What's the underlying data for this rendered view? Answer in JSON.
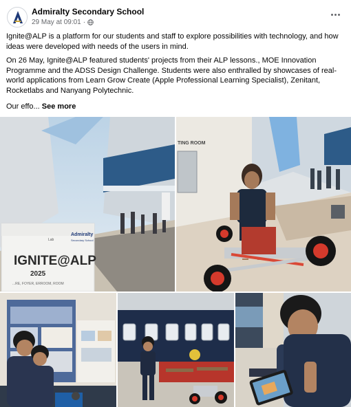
{
  "post": {
    "page_name": "Admiralty Secondary School",
    "timestamp": "29 May at 09:01",
    "separator": "·",
    "avatar_icon": "school-crest-icon",
    "audience_icon": "globe-icon",
    "more_icon": "more-options-icon",
    "paragraphs": [
      "Ignite@ALP is a platform for our students and staff to explore possibilities with technology, and how ideas were developed with needs of the users in mind.",
      "On 26 May, Ignite@ALP featured students' projects from their ALP lessons., MOE Innovation Programme and the ADSS Design Challenge. Students were also enthralled by showcases of real-world applications from Learn Grow Create (Apple Professional Learning Specialist), Zenitant, Rocketlabs and Nanyang Polytechnic."
    ],
    "truncated_text": "Our effo...",
    "see_more_label": "See more"
  },
  "photos": {
    "photo1_sign": {
      "logo_text": "Admiralty",
      "logo_subtext": "Secondary School",
      "small_text": "Lab",
      "title": "IGNITE@ALP",
      "year": "2025",
      "venue": "...RE, FOYER, ERROOM, ROOM"
    },
    "photo2_sign": "TING ROOM"
  },
  "colors": {
    "text_primary": "#050505",
    "text_secondary": "#65676b",
    "link": "#050505"
  }
}
